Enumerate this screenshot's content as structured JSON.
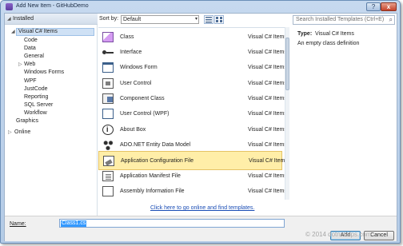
{
  "window": {
    "title": "Add New Item - GitHubDemo",
    "help_label": "?",
    "close_label": "x"
  },
  "tree": {
    "header": "Installed",
    "items": [
      {
        "label": "Visual C# Items",
        "expander": "◢"
      },
      {
        "label": "Code"
      },
      {
        "label": "Data"
      },
      {
        "label": "General"
      },
      {
        "label": "Web",
        "expander": "▷"
      },
      {
        "label": "Windows Forms"
      },
      {
        "label": "WPF"
      },
      {
        "label": "JustCode"
      },
      {
        "label": "Reporting"
      },
      {
        "label": "SQL Server"
      },
      {
        "label": "Workflow"
      },
      {
        "label": "Graphics"
      },
      {
        "label": "Online",
        "expander": "▷"
      }
    ]
  },
  "toolbar": {
    "sort_label": "Sort by:",
    "sort_value": "Default",
    "caret": "▾"
  },
  "search": {
    "placeholder": "Search Installed Templates (Ctrl+E)",
    "icon": "magnifier-icon",
    "glyph": "⌕"
  },
  "templates": [
    {
      "name": "Class",
      "lang": "Visual C# Items",
      "icon": "class-icon"
    },
    {
      "name": "Interface",
      "lang": "Visual C# Items",
      "icon": "interface-icon"
    },
    {
      "name": "Windows Form",
      "lang": "Visual C# Items",
      "icon": "windows-form-icon"
    },
    {
      "name": "User Control",
      "lang": "Visual C# Items",
      "icon": "user-control-icon"
    },
    {
      "name": "Component Class",
      "lang": "Visual C# Items",
      "icon": "component-class-icon"
    },
    {
      "name": "User Control (WPF)",
      "lang": "Visual C# Items",
      "icon": "wpf-user-control-icon"
    },
    {
      "name": "About Box",
      "lang": "Visual C# Items",
      "icon": "about-box-icon"
    },
    {
      "name": "ADO.NET Entity Data Model",
      "lang": "Visual C# Items",
      "icon": "entity-data-model-icon"
    },
    {
      "name": "Application Configuration File",
      "lang": "Visual C# Items",
      "icon": "config-file-icon",
      "selected": true
    },
    {
      "name": "Application Manifest File",
      "lang": "Visual C# Items",
      "icon": "manifest-file-icon"
    },
    {
      "name": "Assembly Information File",
      "lang": "Visual C# Items",
      "icon": "assembly-info-icon"
    }
  ],
  "online_link": "Click here to go online and find templates.",
  "details": {
    "type_label": "Type:",
    "type_value": "Visual C# Items",
    "description": "An empty class definition"
  },
  "name_field": {
    "label": "Name:",
    "value": "Class1.cs"
  },
  "buttons": {
    "add": "Add",
    "cancel": "Cancel"
  },
  "watermark": "© 2014 dotnetalps.com"
}
